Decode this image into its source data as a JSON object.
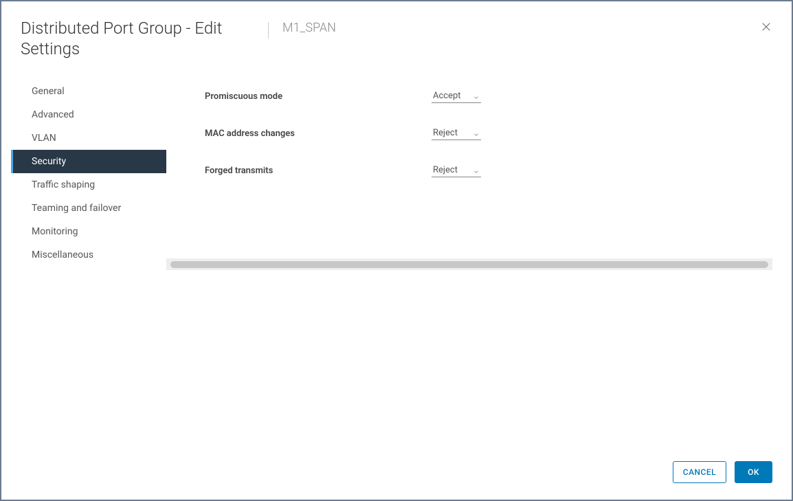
{
  "header": {
    "title": "Distributed Port Group - Edit Settings",
    "subtitle": "M1_SPAN"
  },
  "sidebar": {
    "items": [
      {
        "label": "General",
        "active": false
      },
      {
        "label": "Advanced",
        "active": false
      },
      {
        "label": "VLAN",
        "active": false
      },
      {
        "label": "Security",
        "active": true
      },
      {
        "label": "Traffic shaping",
        "active": false
      },
      {
        "label": "Teaming and failover",
        "active": false
      },
      {
        "label": "Monitoring",
        "active": false
      },
      {
        "label": "Miscellaneous",
        "active": false
      }
    ]
  },
  "form": {
    "promiscuous": {
      "label": "Promiscuous mode",
      "value": "Accept"
    },
    "mac_changes": {
      "label": "MAC address changes",
      "value": "Reject"
    },
    "forged": {
      "label": "Forged transmits",
      "value": "Reject"
    }
  },
  "footer": {
    "cancel": "CANCEL",
    "ok": "OK"
  }
}
